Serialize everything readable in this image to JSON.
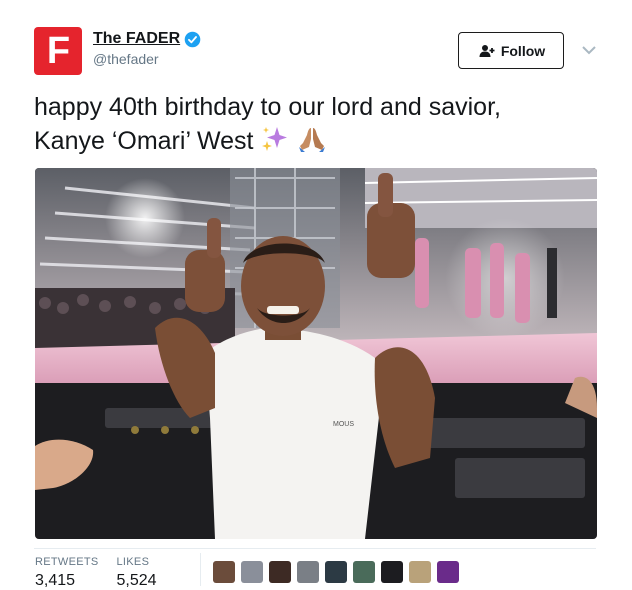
{
  "account": {
    "avatar_letter": "F",
    "name": "The FADER",
    "handle": "@thefader",
    "verified": true
  },
  "actions": {
    "follow_label": "Follow",
    "more_icon": "chevron-down-icon"
  },
  "tweet": {
    "text_line1": "happy 40th birthday to our lord and savior,",
    "text_line2": "Kanye ‘Omari’ West"
  },
  "stats": {
    "retweets_label": "RETWEETS",
    "retweets_value": "3,415",
    "likes_label": "LIKES",
    "likes_value": "5,524"
  },
  "shirt_text": "MOUS",
  "colors": {
    "brand_red": "#e5242d",
    "verified_blue": "#1da1f2",
    "muted": "#657786"
  },
  "likers": [
    "#6b4c3b",
    "#8a8f9a",
    "#3d2a24",
    "#7a7f86",
    "#2c3a44",
    "#4a6b5a",
    "#1c1c20",
    "#b9a27a",
    "#6a2b8a"
  ]
}
